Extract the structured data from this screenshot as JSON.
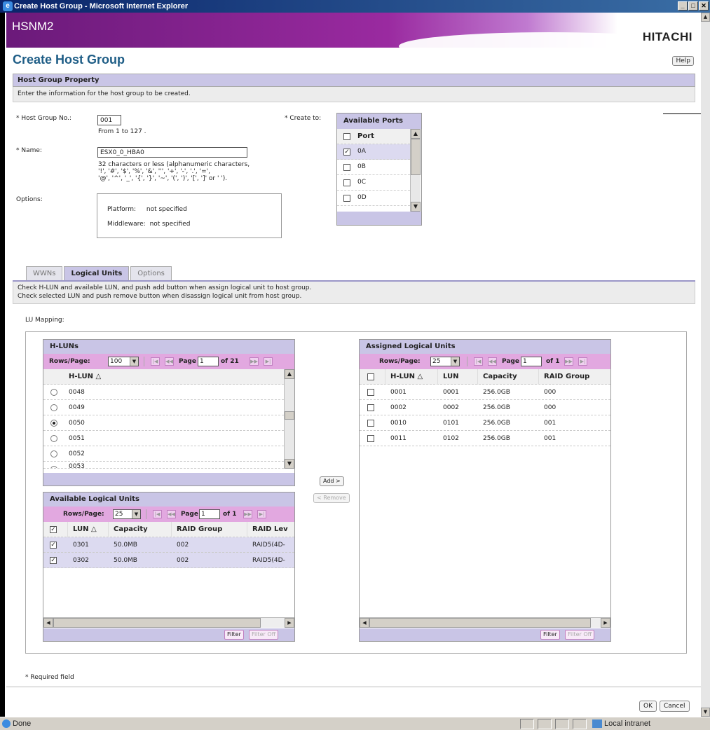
{
  "window": {
    "title": "Create Host Group - Microsoft Internet Explorer",
    "buttons": [
      "_",
      "□",
      "✕"
    ]
  },
  "banner": {
    "app_name": "HSNM2",
    "brand": "HITACHI"
  },
  "page": {
    "title": "Create Host Group",
    "help_label": "Help"
  },
  "host_group_property": {
    "heading": "Host Group Property",
    "note": "Enter the information for the host group to be created.",
    "host_group_no_label": "* Host Group No.:",
    "host_group_no_value": "001",
    "host_group_no_hint": "From 1 to 127 .",
    "name_label": "* Name:",
    "name_value": "ESX0_0_HBA0",
    "name_hint_1": "32 characters or less (alphanumeric characters,",
    "name_hint_2": "'!', '#', '$', '%', '&', ''', '+', '-', '.', '=',",
    "name_hint_3": "'@', '^', '_', '{', '}', '~', '(', ')', '[', ']' or ' ').",
    "options_label": "Options:",
    "platform_label": "Platform:",
    "platform_value": "not specified",
    "middleware_label": "Middleware:",
    "middleware_value": "not specified",
    "create_to_label": "* Create to:"
  },
  "available_ports": {
    "heading": "Available Ports",
    "column": "Port",
    "rows": [
      {
        "port": "0A",
        "checked": true
      },
      {
        "port": "0B",
        "checked": false
      },
      {
        "port": "0C",
        "checked": false
      },
      {
        "port": "0D",
        "checked": false
      }
    ]
  },
  "tabs": [
    {
      "label": "WWNs",
      "active": false
    },
    {
      "label": "Logical Units",
      "active": true
    },
    {
      "label": "Options",
      "active": false
    }
  ],
  "tab_note": {
    "line1": "Check H-LUN and available LUN, and push add button when assign logical unit to host group.",
    "line2": "Check selected LUN and push remove button when disassign logical unit from host group."
  },
  "lu_mapping_label": "LU Mapping:",
  "hluns": {
    "heading": "H-LUNs",
    "rows_per_page_label": "Rows/Page:",
    "rows_per_page": "100",
    "page_label": "Page",
    "page_value": "1",
    "of_label": "of 21",
    "column": "H-LUN △",
    "rows": [
      {
        "value": "0048",
        "selected": false
      },
      {
        "value": "0049",
        "selected": false
      },
      {
        "value": "0050",
        "selected": true
      },
      {
        "value": "0051",
        "selected": false
      },
      {
        "value": "0052",
        "selected": false
      },
      {
        "value": "0053",
        "selected": false
      }
    ]
  },
  "available_lus": {
    "heading": "Available Logical Units",
    "rows_per_page_label": "Rows/Page:",
    "rows_per_page": "25",
    "page_label": "Page",
    "page_value": "1",
    "of_label": "of 1",
    "columns": [
      "LUN △",
      "Capacity",
      "RAID Group",
      "RAID Lev"
    ],
    "rows": [
      {
        "lun": "0301",
        "capacity": "50.0MB",
        "raid_group": "002",
        "raid_level": "RAID5(4D-",
        "checked": true
      },
      {
        "lun": "0302",
        "capacity": "50.0MB",
        "raid_group": "002",
        "raid_level": "RAID5(4D-",
        "checked": true
      }
    ],
    "filter_label": "Filter",
    "filter_off_label": "Filter Off"
  },
  "middle_buttons": {
    "add": "Add >",
    "remove": "< Remove"
  },
  "assigned_lus": {
    "heading": "Assigned Logical Units",
    "rows_per_page_label": "Rows/Page:",
    "rows_per_page": "25",
    "page_label": "Page",
    "page_value": "1",
    "of_label": "of 1",
    "columns": [
      "H-LUN △",
      "LUN",
      "Capacity",
      "RAID Group"
    ],
    "rows": [
      {
        "hlun": "0001",
        "lun": "0001",
        "capacity": "256.0GB",
        "raid_group": "000"
      },
      {
        "hlun": "0002",
        "lun": "0002",
        "capacity": "256.0GB",
        "raid_group": "000"
      },
      {
        "hlun": "0010",
        "lun": "0101",
        "capacity": "256.0GB",
        "raid_group": "001"
      },
      {
        "hlun": "0011",
        "lun": "0102",
        "capacity": "256.0GB",
        "raid_group": "001"
      }
    ],
    "filter_label": "Filter",
    "filter_off_label": "Filter Off"
  },
  "footer": {
    "required_note": "* Required field",
    "ok_label": "OK",
    "cancel_label": "Cancel"
  },
  "statusbar": {
    "status": "Done",
    "zone": "Local intranet"
  },
  "colors": {
    "banner_purple": "#9a2aa0",
    "header_lavender": "#c9c5e6",
    "pager_pink": "#e2a8e0",
    "title_blue": "#1e5d86"
  }
}
